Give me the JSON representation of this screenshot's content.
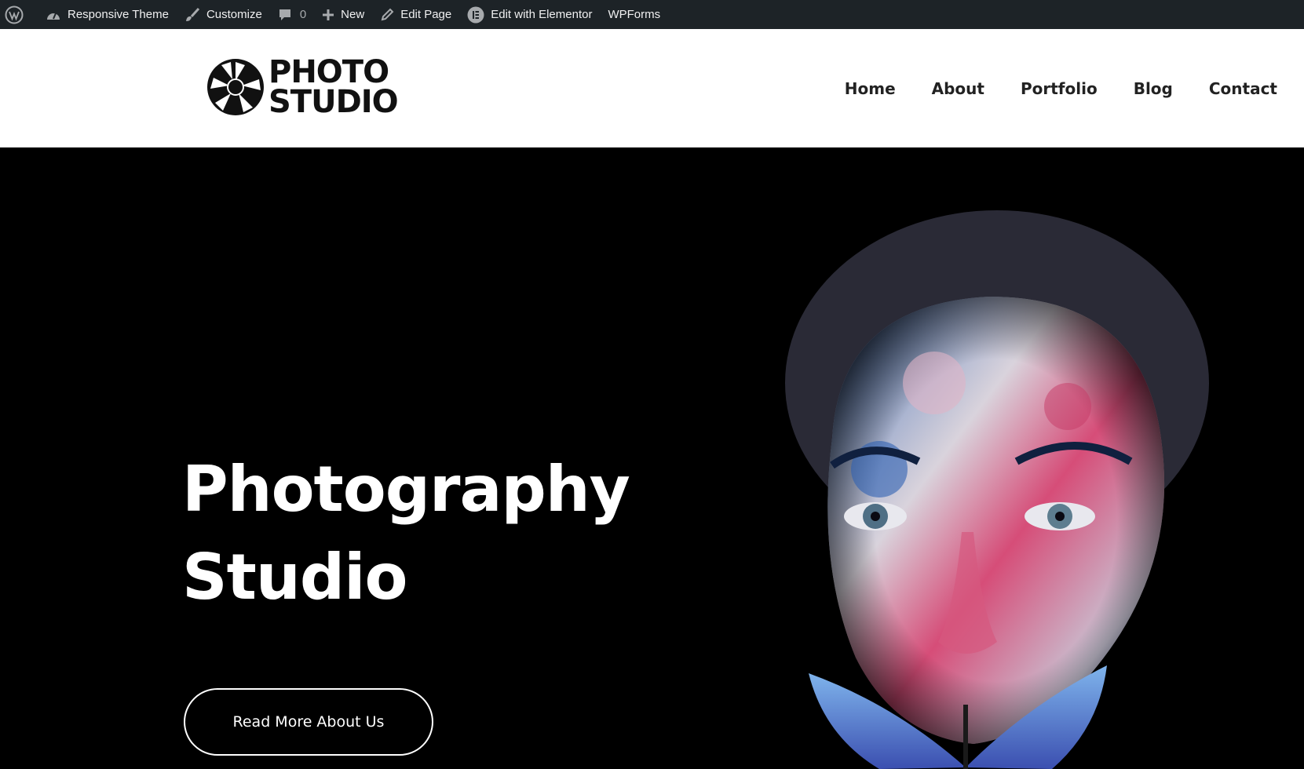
{
  "admin_bar": {
    "site_name": "Responsive Theme",
    "customize": "Customize",
    "comments_count": "0",
    "new": "New",
    "edit_page": "Edit Page",
    "edit_elementor": "Edit with Elementor",
    "wpforms": "WPForms"
  },
  "logo": {
    "line1": "PHOTO",
    "line2": "STUDIO"
  },
  "nav": {
    "home": "Home",
    "about": "About",
    "portfolio": "Portfolio",
    "blog": "Blog",
    "contact": "Contact"
  },
  "hero": {
    "title_line1": "Photography",
    "title_line2": "Studio",
    "button_label": "Read More About Us"
  },
  "colors": {
    "admin_bar_bg": "#1d2327",
    "hero_bg": "#000000",
    "header_bg": "#ffffff"
  }
}
